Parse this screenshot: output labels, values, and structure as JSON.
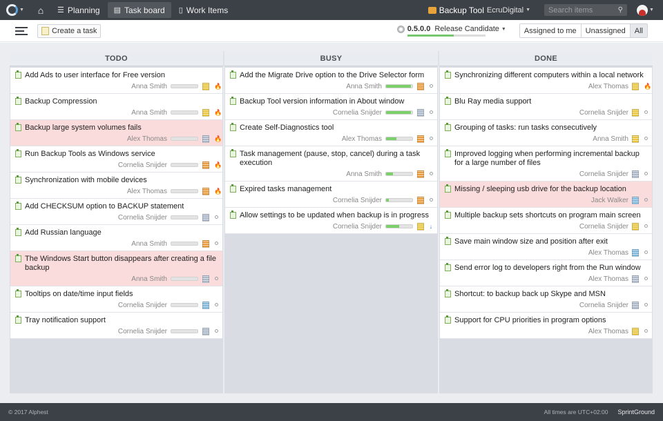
{
  "nav": {
    "tabs": [
      {
        "label": "Planning",
        "icon": "planning-icon"
      },
      {
        "label": "Task board",
        "icon": "board-icon"
      },
      {
        "label": "Work Items",
        "icon": "document-icon"
      }
    ],
    "project": {
      "name": "Backup Tool",
      "org": "EcruDigital"
    },
    "search_placeholder": "Search items"
  },
  "toolbar": {
    "create_label": "Create a task",
    "release": {
      "version": "0.5.0.0",
      "name": "Release Candidate",
      "progress": 0.6
    },
    "filters": [
      "Assigned to me",
      "Unassigned",
      "All"
    ],
    "active_filter": "All"
  },
  "board": {
    "columns": [
      {
        "title": "TODO",
        "cards": [
          {
            "title": "Add Ads to user interface for Free version",
            "assignee": "Anna Smith",
            "progress": 0,
            "type_color": "#e8c53a",
            "priority": "fire",
            "highlight": false
          },
          {
            "title": "Backup Compression",
            "assignee": "Anna Smith",
            "progress": 0,
            "type_color": "#e8c53a",
            "priority": "fire",
            "highlight": false
          },
          {
            "title": "Backup large system volumes fails",
            "assignee": "Alex Thomas",
            "progress": 0,
            "type_color": "#a9b7c9",
            "priority": "fire",
            "highlight": true
          },
          {
            "title": "Run Backup Tools as Windows service",
            "assignee": "Cornelia Snijder",
            "progress": 0,
            "type_color": "#e89a3a",
            "priority": "fire",
            "highlight": false
          },
          {
            "title": "Synchronization with mobile devices",
            "assignee": "Alex Thomas",
            "progress": 0,
            "type_color": "#e89a3a",
            "priority": "fire",
            "highlight": false
          },
          {
            "title": "Add CHECKSUM option to BACKUP statement",
            "assignee": "Cornelia Snijder",
            "progress": 0,
            "type_color": "#a9b7c9",
            "priority": "dot",
            "highlight": false
          },
          {
            "title": "Add Russian language",
            "assignee": "Anna Smith",
            "progress": 0,
            "type_color": "#e89a3a",
            "priority": "dot",
            "highlight": false
          },
          {
            "title": "The Windows Start button disappears after creating a file backup",
            "assignee": "Anna Smith",
            "progress": 0,
            "type_color": "#a9b7c9",
            "priority": "dot",
            "highlight": true
          },
          {
            "title": "Tooltips on date/time input fields",
            "assignee": "Cornelia Snijder",
            "progress": 0,
            "type_color": "#7fb6dc",
            "priority": "dot",
            "highlight": false
          },
          {
            "title": "Tray notification support",
            "assignee": "Cornelia Snijder",
            "progress": 0,
            "type_color": "#a9b7c9",
            "priority": "dot",
            "highlight": false
          }
        ]
      },
      {
        "title": "BUSY",
        "cards": [
          {
            "title": "Add the Migrate Drive option to the Drive Selector form",
            "assignee": "Anna Smith",
            "progress": 0.95,
            "type_color": "#e89a3a",
            "priority": "dot",
            "highlight": false
          },
          {
            "title": "Backup Tool version information in About window",
            "assignee": "Cornelia Snijder",
            "progress": 0.95,
            "type_color": "#a9b7c9",
            "priority": "dot",
            "highlight": false
          },
          {
            "title": "Create Self-Diagnostics tool",
            "assignee": "Alex Thomas",
            "progress": 0.4,
            "type_color": "#e89a3a",
            "priority": "dot",
            "highlight": false
          },
          {
            "title": "Task management (pause, stop, cancel) during a task execution",
            "assignee": "Anna Smith",
            "progress": 0.25,
            "type_color": "#e89a3a",
            "priority": "dot",
            "highlight": false
          },
          {
            "title": "Expired tasks management",
            "assignee": "Cornelia Snijder",
            "progress": 0.1,
            "type_color": "#e89a3a",
            "priority": "dot",
            "highlight": false
          },
          {
            "title": "Allow settings to be updated when backup is in progress",
            "assignee": "Cornelia Snijder",
            "progress": 0.5,
            "type_color": "#e8c53a",
            "priority": "down",
            "highlight": false
          }
        ]
      },
      {
        "title": "DONE",
        "cards": [
          {
            "title": "Synchronizing different computers within a local network",
            "assignee": "Alex Thomas",
            "progress": null,
            "type_color": "#e8c53a",
            "priority": "fire",
            "highlight": false
          },
          {
            "title": "Blu Ray media support",
            "assignee": "Cornelia Snijder",
            "progress": null,
            "type_color": "#e8c53a",
            "priority": "dot",
            "highlight": false
          },
          {
            "title": "Grouping of tasks: run tasks consecutively",
            "assignee": "Anna Smith",
            "progress": null,
            "type_color": "#e8c53a",
            "priority": "dot",
            "highlight": false
          },
          {
            "title": "Improved logging when performing incremental backup for a large number of files",
            "assignee": "Cornelia Snijder",
            "progress": null,
            "type_color": "#a9b7c9",
            "priority": "dot",
            "highlight": false
          },
          {
            "title": "Missing / sleeping usb drive for the backup location",
            "assignee": "Jack Walker",
            "progress": null,
            "type_color": "#7fb6dc",
            "priority": "dot",
            "highlight": true
          },
          {
            "title": "Multiple backup sets shortcuts on program main screen",
            "assignee": "Cornelia Snijder",
            "progress": null,
            "type_color": "#e8c53a",
            "priority": "dot",
            "highlight": false
          },
          {
            "title": "Save main window size and position after exit",
            "assignee": "Alex Thomas",
            "progress": null,
            "type_color": "#7fb6dc",
            "priority": "dot",
            "highlight": false
          },
          {
            "title": "Send error log to developers right from the Run window",
            "assignee": "Alex Thomas",
            "progress": null,
            "type_color": "#a9b7c9",
            "priority": "dot",
            "highlight": false
          },
          {
            "title": "Shortcut: to backup back up Skype and MSN",
            "assignee": "Cornelia Snijder",
            "progress": null,
            "type_color": "#a9b7c9",
            "priority": "dot",
            "highlight": false
          },
          {
            "title": "Support for CPU priorities in program options",
            "assignee": "Alex Thomas",
            "progress": null,
            "type_color": "#e8c53a",
            "priority": "dot",
            "highlight": false
          }
        ]
      }
    ]
  },
  "footer": {
    "copyright": "© 2017 Alphest",
    "timezone": "All times are UTC+02:00",
    "brand": "SprintGround"
  }
}
